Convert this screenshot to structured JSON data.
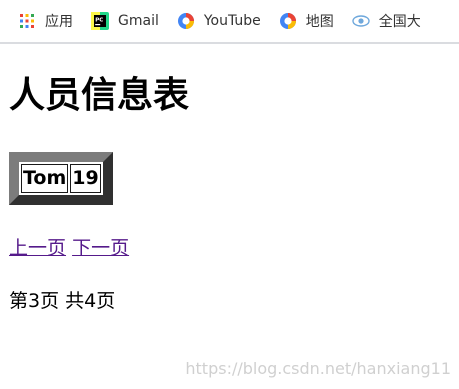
{
  "bookmarks": [
    {
      "label": "应用",
      "icon": "apps-grid-icon"
    },
    {
      "label": "Gmail",
      "icon": "pycharm-icon"
    },
    {
      "label": "YouTube",
      "icon": "swirl-icon"
    },
    {
      "label": "地图",
      "icon": "swirl-icon"
    },
    {
      "label": "全国大",
      "icon": "eye-icon"
    }
  ],
  "page": {
    "title": "人员信息表"
  },
  "table": {
    "rows": [
      {
        "name": "Tom",
        "age": "19"
      }
    ]
  },
  "pager": {
    "prev_label": "上一页",
    "next_label": "下一页",
    "status": "第3页 共4页"
  },
  "watermark": "https://blog.csdn.net/hanxiang11"
}
